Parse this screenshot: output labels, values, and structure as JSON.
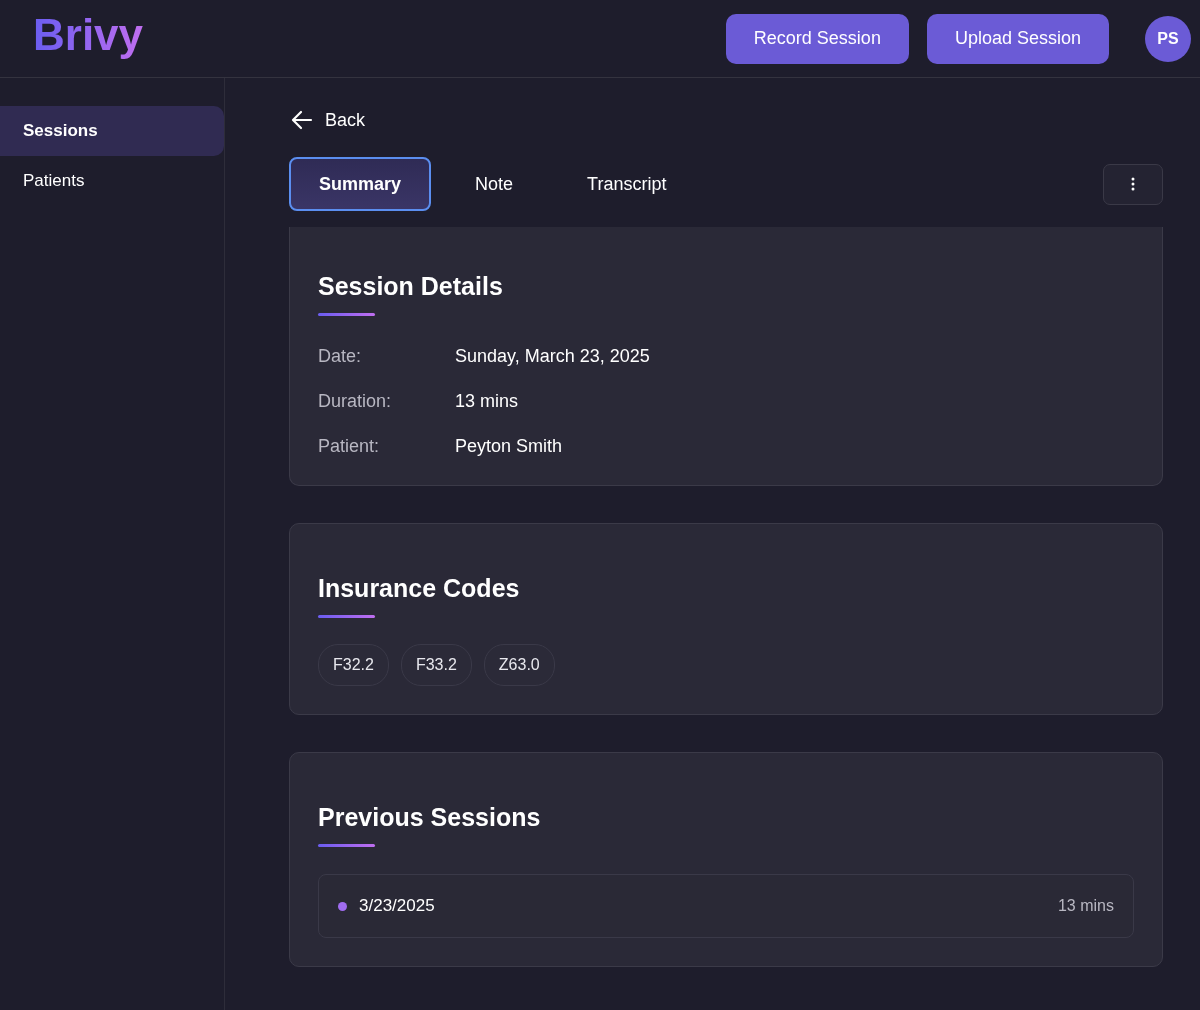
{
  "header": {
    "logo": "Brivy",
    "actions": [
      {
        "label": "Record Session"
      },
      {
        "label": "Upload Session"
      }
    ],
    "avatar": "PS"
  },
  "sidebar": {
    "items": [
      {
        "label": "Sessions",
        "selected": true
      },
      {
        "label": "Patients",
        "selected": false
      }
    ]
  },
  "back": "Back",
  "tabs": [
    {
      "label": "Summary",
      "selected": true
    },
    {
      "label": "Note",
      "selected": false
    },
    {
      "label": "Transcript",
      "selected": false
    }
  ],
  "session_details": {
    "title": "Session Details",
    "fields": [
      {
        "label": "Date:",
        "value": "Sunday, March 23, 2025"
      },
      {
        "label": "Duration:",
        "value": "13 mins"
      },
      {
        "label": "Patient:",
        "value": "Peyton Smith"
      }
    ]
  },
  "insurance_codes": {
    "title": "Insurance Codes",
    "codes": [
      "F32.2",
      "F33.2",
      "Z63.0"
    ]
  },
  "previous_sessions": {
    "title": "Previous Sessions",
    "items": [
      {
        "date": "3/23/2025",
        "duration": "13 mins",
        "color": "#a06cf0"
      }
    ]
  }
}
